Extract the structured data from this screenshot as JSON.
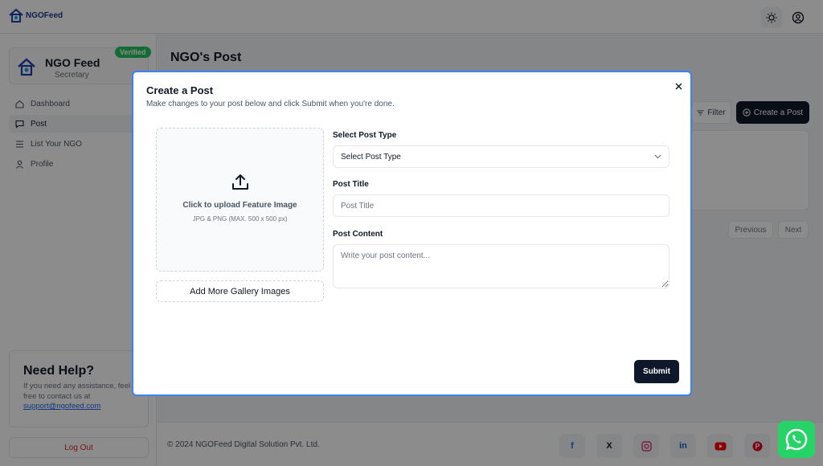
{
  "app": {
    "logo_text": "NGOFeed"
  },
  "sidebar": {
    "profile": {
      "name": "NGO Feed",
      "role": "Secretary",
      "badge": "Verified"
    },
    "items": [
      {
        "label": "Dashboard",
        "icon": "home-icon"
      },
      {
        "label": "Post",
        "icon": "message-icon"
      },
      {
        "label": "List Your NGO",
        "icon": "list-icon"
      },
      {
        "label": "Profile",
        "icon": "user-icon"
      }
    ],
    "help": {
      "title": "Need Help?",
      "text": "If you need any assistance, feel free to contact us at",
      "email": "support@ngofeed.com"
    },
    "logout_label": "Log Out"
  },
  "main": {
    "title": "NGO's Post",
    "filter_label": "Filter",
    "create_label": "Create a Post",
    "previous_label": "Previous",
    "next_label": "Next"
  },
  "footer": {
    "copyright": "© 2024 NGOFeed Digital Solution Pvt. Ltd.",
    "social": [
      "facebook-icon",
      "x-icon",
      "instagram-icon",
      "linkedin-icon",
      "youtube-icon",
      "pinterest-icon"
    ]
  },
  "modal": {
    "title": "Create a Post",
    "description": "Make changes to your post below and click Submit when you're done.",
    "upload": {
      "title": "Click to upload Feature Image",
      "hint": "JPG & PNG (MAX. 500 x 500 px)"
    },
    "gallery_label": "Add More Gallery Images",
    "post_type": {
      "label": "Select Post Type",
      "value": "Select Post Type"
    },
    "post_title": {
      "label": "Post Title",
      "placeholder": "Post Title"
    },
    "post_content": {
      "label": "Post Content",
      "placeholder": "Write your post content..."
    },
    "submit_label": "Submit"
  },
  "colors": {
    "accent_dark": "#0f172a",
    "verified": "#22c55e",
    "modal_border": "#3b82f6",
    "whatsapp": "#25d366",
    "logout": "#dc2626"
  }
}
